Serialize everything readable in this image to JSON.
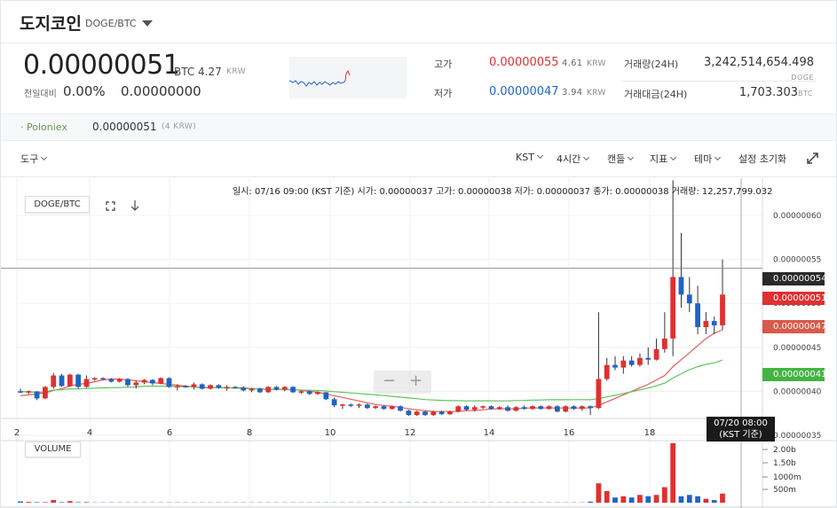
{
  "header": {
    "coin_name": "도지코인",
    "pair": "DOGE/BTC"
  },
  "price": {
    "current": "0.00000051",
    "unit": "BTC",
    "krw": "4.27",
    "krw_unit": "KRW",
    "change_label": "전일대비",
    "change_rate": "0.00%",
    "change_amount": "0.00000000"
  },
  "stats": {
    "high_label": "고가",
    "high": "0.00000055",
    "high_krw": "4.61",
    "high_krw_unit": "KRW",
    "low_label": "저가",
    "low": "0.00000047",
    "low_krw": "3.94",
    "low_krw_unit": "KRW",
    "volume_label": "거래량(24H)",
    "volume": "3,242,514,654.498",
    "volume_unit": "DOGE",
    "amount_label": "거래대금(24H)",
    "amount": "1,703.303",
    "amount_unit": "BTC"
  },
  "exchange": {
    "name": "· Poloniex",
    "price": "0.00000051",
    "krw": "(4 KRW)"
  },
  "toolbar": {
    "tools_label": "도구",
    "timezone": "KST",
    "interval": "4시간",
    "chart_type": "캔들",
    "indicator": "지표",
    "theme": "테마",
    "reset": "설정 초기화"
  },
  "ohlc_line": "일시: 07/16 09:00 (KST 기준) 시가: 0.00000037 고가: 0.00000038 저가: 0.00000037 종가: 0.00000038 거래량: 12,257,799.032",
  "chart_legend": "DOGE/BTC",
  "volume_legend": "VOLUME",
  "zoom": {
    "minus": "−",
    "plus": "+"
  },
  "price_tags": {
    "crosshair": "0.00000054",
    "current": "0.00000051",
    "ma_red": "0.00000047",
    "ma_green": "0.00000041"
  },
  "time_tag": {
    "line1": "07/20 08:00",
    "line2": "(KST 기준)"
  },
  "colors": {
    "up": "#e03030",
    "down": "#1e64c8",
    "ma_short": "#e85a5a",
    "ma_long": "#5fc45f"
  },
  "chart_data": {
    "type": "candlestick",
    "x_axis_ticks": [
      "2",
      "4",
      "6",
      "8",
      "10",
      "12",
      "14",
      "16",
      "18"
    ],
    "y_axis_ticks": [
      "0.00000060",
      "0.00000055",
      "0.00000050",
      "0.00000045",
      "0.00000040",
      "0.00000035"
    ],
    "volume_axis_ticks": [
      "2.00b",
      "1.50b",
      "1000m",
      "500m"
    ],
    "ylim": [
      3.5e-07,
      6e-07
    ],
    "candles": [
      [
        4e-07,
        4.03e-07,
        3.98e-07,
        3.99e-07
      ],
      [
        3.99e-07,
        4.01e-07,
        3.97e-07,
        4e-07
      ],
      [
        4e-07,
        4e-07,
        3.9e-07,
        3.92e-07
      ],
      [
        3.92e-07,
        4.06e-07,
        3.91e-07,
        4.05e-07
      ],
      [
        4.05e-07,
        4.21e-07,
        4.03e-07,
        4.18e-07
      ],
      [
        4.18e-07,
        4.2e-07,
        4.05e-07,
        4.06e-07
      ],
      [
        4.06e-07,
        4.2e-07,
        4.05e-07,
        4.19e-07
      ],
      [
        4.19e-07,
        4.2e-07,
        4.03e-07,
        4.05e-07
      ],
      [
        4.05e-07,
        4.18e-07,
        4.04e-07,
        4.14e-07
      ],
      [
        4.14e-07,
        4.16e-07,
        4.12e-07,
        4.15e-07
      ],
      [
        4.15e-07,
        4.16e-07,
        4.13e-07,
        4.14e-07
      ],
      [
        4.14e-07,
        4.15e-07,
        4.1e-07,
        4.11e-07
      ],
      [
        4.11e-07,
        4.15e-07,
        4.1e-07,
        4.14e-07
      ],
      [
        4.14e-07,
        4.15e-07,
        4.05e-07,
        4.07e-07
      ],
      [
        4.07e-07,
        4.12e-07,
        4.03e-07,
        4.1e-07
      ],
      [
        4.1e-07,
        4.14e-07,
        4.08e-07,
        4.13e-07
      ],
      [
        4.13e-07,
        4.14e-07,
        4.07e-07,
        4.09e-07
      ],
      [
        4.09e-07,
        4.16e-07,
        4.08e-07,
        4.15e-07
      ],
      [
        4.15e-07,
        4.16e-07,
        4.04e-07,
        4.05e-07
      ],
      [
        4.05e-07,
        4.08e-07,
        4.01e-07,
        4.06e-07
      ],
      [
        4.06e-07,
        4.07e-07,
        4.04e-07,
        4.05e-07
      ],
      [
        4.05e-07,
        4.1e-07,
        4.02e-07,
        4.08e-07
      ],
      [
        4.08e-07,
        4.09e-07,
        4.02e-07,
        4.03e-07
      ],
      [
        4.03e-07,
        4.08e-07,
        4.02e-07,
        4.07e-07
      ],
      [
        4.07e-07,
        4.08e-07,
        4.03e-07,
        4.04e-07
      ],
      [
        4.04e-07,
        4.07e-07,
        4.01e-07,
        4.05e-07
      ],
      [
        4.05e-07,
        4.06e-07,
        4.03e-07,
        4.04e-07
      ],
      [
        4.04e-07,
        4.06e-07,
        4e-07,
        4.01e-07
      ],
      [
        4.01e-07,
        4.04e-07,
        3.99e-07,
        4.03e-07
      ],
      [
        4.03e-07,
        4.04e-07,
        3.98e-07,
        3.99e-07
      ],
      [
        3.99e-07,
        4.06e-07,
        3.98e-07,
        4.05e-07
      ],
      [
        4.05e-07,
        4.06e-07,
        4.01e-07,
        4.02e-07
      ],
      [
        4.02e-07,
        4.06e-07,
        4e-07,
        4.05e-07
      ],
      [
        4.05e-07,
        4.06e-07,
        3.98e-07,
        3.99e-07
      ],
      [
        3.99e-07,
        4.01e-07,
        3.97e-07,
        4e-07
      ],
      [
        4e-07,
        4.01e-07,
        3.96e-07,
        3.97e-07
      ],
      [
        3.97e-07,
        4e-07,
        3.96e-07,
        3.99e-07
      ],
      [
        3.99e-07,
        3.99e-07,
        3.9e-07,
        3.91e-07
      ],
      [
        3.91e-07,
        3.93e-07,
        3.82e-07,
        3.84e-07
      ],
      [
        3.84e-07,
        3.86e-07,
        3.8e-07,
        3.85e-07
      ],
      [
        3.85e-07,
        3.86e-07,
        3.82e-07,
        3.84e-07
      ],
      [
        3.84e-07,
        3.86e-07,
        3.81e-07,
        3.85e-07
      ],
      [
        3.85e-07,
        3.86e-07,
        3.8e-07,
        3.81e-07
      ],
      [
        3.81e-07,
        3.84e-07,
        3.8e-07,
        3.83e-07
      ],
      [
        3.83e-07,
        3.84e-07,
        3.79e-07,
        3.8e-07
      ],
      [
        3.8e-07,
        3.84e-07,
        3.79e-07,
        3.83e-07
      ],
      [
        3.83e-07,
        3.84e-07,
        3.77e-07,
        3.78e-07
      ],
      [
        3.78e-07,
        3.79e-07,
        3.72e-07,
        3.73e-07
      ],
      [
        3.73e-07,
        3.78e-07,
        3.72e-07,
        3.77e-07
      ],
      [
        3.77e-07,
        3.78e-07,
        3.72e-07,
        3.73e-07
      ],
      [
        3.73e-07,
        3.78e-07,
        3.72e-07,
        3.77e-07
      ],
      [
        3.77e-07,
        3.78e-07,
        3.73e-07,
        3.74e-07
      ],
      [
        3.74e-07,
        3.78e-07,
        3.73e-07,
        3.77e-07
      ],
      [
        3.77e-07,
        3.84e-07,
        3.76e-07,
        3.83e-07
      ],
      [
        3.83e-07,
        3.84e-07,
        3.78e-07,
        3.79e-07
      ],
      [
        3.79e-07,
        3.84e-07,
        3.77e-07,
        3.82e-07
      ],
      [
        3.82e-07,
        3.84e-07,
        3.8e-07,
        3.83e-07
      ],
      [
        3.83e-07,
        3.84e-07,
        3.79e-07,
        3.8e-07
      ],
      [
        3.8e-07,
        3.83e-07,
        3.79e-07,
        3.82e-07
      ],
      [
        3.82e-07,
        3.84e-07,
        3.77e-07,
        3.78e-07
      ],
      [
        3.78e-07,
        3.83e-07,
        3.77e-07,
        3.82e-07
      ],
      [
        3.82e-07,
        3.84e-07,
        3.79e-07,
        3.8e-07
      ],
      [
        3.8e-07,
        3.84e-07,
        3.79e-07,
        3.83e-07
      ],
      [
        3.83e-07,
        3.84e-07,
        3.79e-07,
        3.8e-07
      ],
      [
        3.8e-07,
        3.84e-07,
        3.79e-07,
        3.83e-07
      ],
      [
        3.83e-07,
        3.84e-07,
        3.76e-07,
        3.77e-07
      ],
      [
        3.77e-07,
        3.84e-07,
        3.76e-07,
        3.83e-07
      ],
      [
        3.83e-07,
        3.84e-07,
        3.79e-07,
        3.8e-07
      ],
      [
        3.8e-07,
        3.84e-07,
        3.78e-07,
        3.83e-07
      ],
      [
        3.83e-07,
        3.84e-07,
        3.73e-07,
        3.81e-07
      ],
      [
        3.81e-07,
        4.9e-07,
        3.8e-07,
        4.14e-07
      ],
      [
        4.14e-07,
        4.38e-07,
        4.12e-07,
        4.3e-07
      ],
      [
        4.3e-07,
        4.4e-07,
        4.24e-07,
        4.27e-07
      ],
      [
        4.27e-07,
        4.4e-07,
        4.2e-07,
        4.35e-07
      ],
      [
        4.35e-07,
        4.4e-07,
        4.28e-07,
        4.3e-07
      ],
      [
        4.3e-07,
        4.43e-07,
        4.28e-07,
        4.38e-07
      ],
      [
        4.38e-07,
        4.5e-07,
        4.3e-07,
        4.36e-07
      ],
      [
        4.36e-07,
        4.6e-07,
        4.35e-07,
        4.48e-07
      ],
      [
        4.48e-07,
        4.9e-07,
        4.44e-07,
        4.6e-07
      ],
      [
        4.6e-07,
        6.4e-07,
        4.4e-07,
        5.3e-07
      ],
      [
        5.3e-07,
        5.8e-07,
        4.95e-07,
        5.1e-07
      ],
      [
        5.1e-07,
        5.3e-07,
        4.9e-07,
        5e-07
      ],
      [
        5e-07,
        5.2e-07,
        4.65e-07,
        4.73e-07
      ],
      [
        4.73e-07,
        4.9e-07,
        4.65e-07,
        4.8e-07
      ],
      [
        4.8e-07,
        4.85e-07,
        4.65e-07,
        4.75e-07
      ],
      [
        4.75e-07,
        5.5e-07,
        4.7e-07,
        5.1e-07
      ]
    ],
    "volumes": [
      0.05,
      0.03,
      0.02,
      0.02,
      0.1,
      0.02,
      0.06,
      0.02,
      0.02,
      0.01,
      0.01,
      0.01,
      0.01,
      0.01,
      0.01,
      0.01,
      0.01,
      0.01,
      0.01,
      0.01,
      0.01,
      0.01,
      0.01,
      0.01,
      0.01,
      0.01,
      0.01,
      0.01,
      0.01,
      0.01,
      0.01,
      0.01,
      0.01,
      0.01,
      0.01,
      0.01,
      0.01,
      0.01,
      0.01,
      0.01,
      0.01,
      0.01,
      0.01,
      0.01,
      0.01,
      0.01,
      0.01,
      0.01,
      0.01,
      0.01,
      0.01,
      0.01,
      0.01,
      0.01,
      0.01,
      0.01,
      0.01,
      0.01,
      0.01,
      0.01,
      0.01,
      0.01,
      0.01,
      0.01,
      0.01,
      0.01,
      0.01,
      0.01,
      0.01,
      0.04,
      0.75,
      0.45,
      0.2,
      0.25,
      0.2,
      0.3,
      0.25,
      0.3,
      0.6,
      2.3,
      0.25,
      0.3,
      0.25,
      0.15,
      0.1,
      0.35
    ],
    "ma_short": [
      3.95e-07,
      3.96e-07,
      3.97e-07,
      3.98e-07,
      4.01e-07,
      4.03e-07,
      4.06e-07,
      4.08e-07,
      4.09e-07,
      4.11e-07,
      4.13e-07,
      4.14e-07,
      4.14e-07,
      4.13e-07,
      4.12e-07,
      4.11e-07,
      4.1e-07,
      4.09e-07,
      4.08e-07,
      4.07e-07,
      4.06e-07,
      4.05e-07,
      4.04e-07,
      4.04e-07,
      4.04e-07,
      4.04e-07,
      4.04e-07,
      4.04e-07,
      4.03e-07,
      4.03e-07,
      4.02e-07,
      4.02e-07,
      4.02e-07,
      4.02e-07,
      4.01e-07,
      4e-07,
      3.99e-07,
      3.97e-07,
      3.95e-07,
      3.93e-07,
      3.91e-07,
      3.89e-07,
      3.87e-07,
      3.85e-07,
      3.84e-07,
      3.83e-07,
      3.82e-07,
      3.8e-07,
      3.79e-07,
      3.78e-07,
      3.77e-07,
      3.77e-07,
      3.77e-07,
      3.77e-07,
      3.78e-07,
      3.78e-07,
      3.79e-07,
      3.8e-07,
      3.8e-07,
      3.8e-07,
      3.8e-07,
      3.81e-07,
      3.81e-07,
      3.81e-07,
      3.81e-07,
      3.81e-07,
      3.81e-07,
      3.81e-07,
      3.81e-07,
      3.81e-07,
      3.84e-07,
      3.88e-07,
      3.92e-07,
      3.96e-07,
      4e-07,
      4.04e-07,
      4.08e-07,
      4.13e-07,
      4.18e-07,
      4.28e-07,
      4.36e-07,
      4.44e-07,
      4.52e-07,
      4.6e-07,
      4.66e-07,
      4.7e-07
    ]
  }
}
